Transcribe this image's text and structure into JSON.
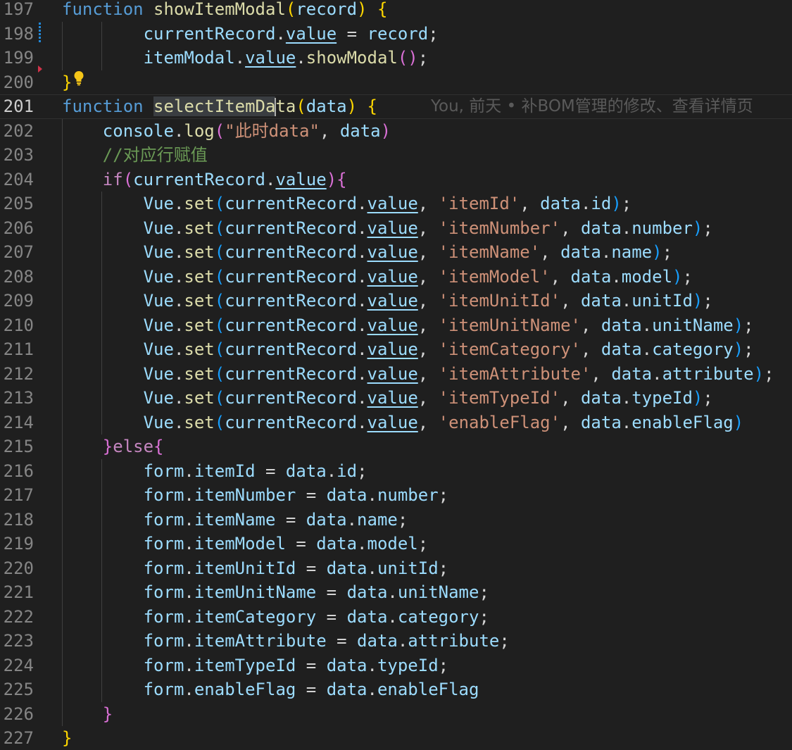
{
  "editor": {
    "line_numbers": [
      "197",
      "198",
      "199",
      "200",
      "201",
      "202",
      "203",
      "204",
      "205",
      "206",
      "207",
      "208",
      "209",
      "210",
      "211",
      "212",
      "213",
      "214",
      "215",
      "216",
      "217",
      "218",
      "219",
      "220",
      "221",
      "222",
      "223",
      "224",
      "225",
      "226",
      "227"
    ],
    "current_line": "201",
    "blame": {
      "text": "You, 前天 • 补BOM管理的修改、查看详情页"
    },
    "tokens": {
      "kw_function": "function",
      "kw_if": "if",
      "kw_else": "else",
      "fn_showItemModal": "showItemModal",
      "fn_selectItemDa": "selectItemDa",
      "fn_selectItemData_tail": "ta",
      "fn_showModal": "showModal",
      "fn_set": "set",
      "fn_log": "log",
      "var_record": "record",
      "var_currentRecord": "currentRecord",
      "var_value": "value",
      "var_itemModal": "itemModal",
      "var_data": "data",
      "var_console": "console",
      "var_Vue": "Vue",
      "var_form": "form",
      "str_log": "\"此时data\"",
      "comment": "//对应行赋值"
    },
    "vue_sets": [
      {
        "key": "'itemId'",
        "field": "id"
      },
      {
        "key": "'itemNumber'",
        "field": "number"
      },
      {
        "key": "'itemName'",
        "field": "name"
      },
      {
        "key": "'itemModel'",
        "field": "model"
      },
      {
        "key": "'itemUnitId'",
        "field": "unitId"
      },
      {
        "key": "'itemUnitName'",
        "field": "unitName"
      },
      {
        "key": "'itemCategory'",
        "field": "category"
      },
      {
        "key": "'itemAttribute'",
        "field": "attribute"
      },
      {
        "key": "'itemTypeId'",
        "field": "typeId"
      },
      {
        "key": "'enableFlag'",
        "field": "enableFlag"
      }
    ],
    "form_assigns": [
      {
        "prop": "itemId",
        "field": "id"
      },
      {
        "prop": "itemNumber",
        "field": "number"
      },
      {
        "prop": "itemName",
        "field": "name"
      },
      {
        "prop": "itemModel",
        "field": "model"
      },
      {
        "prop": "itemUnitId",
        "field": "unitId"
      },
      {
        "prop": "itemUnitName",
        "field": "unitName"
      },
      {
        "prop": "itemCategory",
        "field": "category"
      },
      {
        "prop": "itemAttribute",
        "field": "attribute"
      },
      {
        "prop": "itemTypeId",
        "field": "typeId"
      },
      {
        "prop": "enableFlag",
        "field": "enableFlag"
      }
    ]
  },
  "colors": {
    "background": "#1f1f1f",
    "keyword": "#569cd6",
    "function": "#dcdcaa",
    "variable": "#9cdcfe",
    "string": "#ce9178",
    "comment": "#6a9955",
    "control": "#c586c0",
    "bracket_gold": "#ffd700",
    "bracket_orchid": "#da70d6",
    "bracket_blue": "#179fff"
  }
}
